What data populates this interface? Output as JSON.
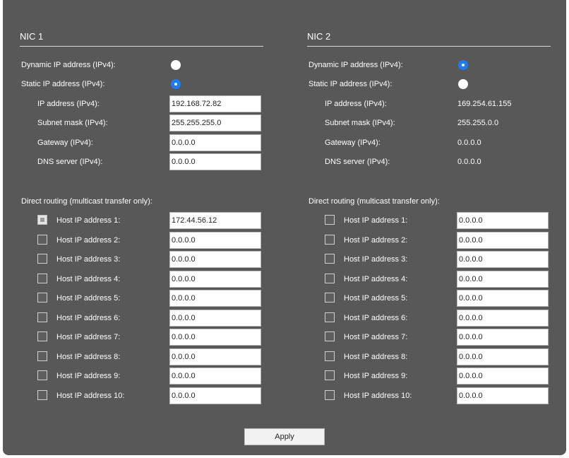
{
  "nic1": {
    "title": "NIC 1",
    "dynamic_label": "Dynamic IP address (IPv4):",
    "static_label": "Static IP address (IPv4):",
    "mode": "static",
    "ip_label": "IP address (IPv4):",
    "ip_value": "192.168.72.82",
    "subnet_label": "Subnet mask (IPv4):",
    "subnet_value": "255.255.255.0",
    "gateway_label": "Gateway (IPv4):",
    "gateway_value": "0.0.0.0",
    "dns_label": "DNS server (IPv4):",
    "dns_value": "0.0.0.0",
    "routing_label": "Direct routing (multicast transfer only):",
    "hosts": [
      {
        "label": "Host IP address 1:",
        "value": "172.44.56.12",
        "checked": true
      },
      {
        "label": "Host IP address 2:",
        "value": "0.0.0.0",
        "checked": false
      },
      {
        "label": "Host IP address 3:",
        "value": "0.0.0.0",
        "checked": false
      },
      {
        "label": "Host IP address 4:",
        "value": "0.0.0.0",
        "checked": false
      },
      {
        "label": "Host IP address 5:",
        "value": "0.0.0.0",
        "checked": false
      },
      {
        "label": "Host IP address 6:",
        "value": "0.0.0.0",
        "checked": false
      },
      {
        "label": "Host IP address 7:",
        "value": "0.0.0.0",
        "checked": false
      },
      {
        "label": "Host IP address 8:",
        "value": "0.0.0.0",
        "checked": false
      },
      {
        "label": "Host IP address 9:",
        "value": "0.0.0.0",
        "checked": false
      },
      {
        "label": "Host IP address 10:",
        "value": "0.0.0.0",
        "checked": false
      }
    ]
  },
  "nic2": {
    "title": "NIC 2",
    "dynamic_label": "Dynamic IP address (IPv4):",
    "static_label": "Static IP address (IPv4):",
    "mode": "dynamic",
    "ip_label": "IP address (IPv4):",
    "ip_value": "169.254.61.155",
    "subnet_label": "Subnet mask (IPv4):",
    "subnet_value": "255.255.0.0",
    "gateway_label": "Gateway (IPv4):",
    "gateway_value": "0.0.0.0",
    "dns_label": "DNS server (IPv4):",
    "dns_value": "0.0.0.0",
    "routing_label": "Direct routing (multicast transfer only):",
    "hosts": [
      {
        "label": "Host IP address 1:",
        "value": "0.0.0.0",
        "checked": false
      },
      {
        "label": "Host IP address 2:",
        "value": "0.0.0.0",
        "checked": false
      },
      {
        "label": "Host IP address 3:",
        "value": "0.0.0.0",
        "checked": false
      },
      {
        "label": "Host IP address 4:",
        "value": "0.0.0.0",
        "checked": false
      },
      {
        "label": "Host IP address 5:",
        "value": "0.0.0.0",
        "checked": false
      },
      {
        "label": "Host IP address 6:",
        "value": "0.0.0.0",
        "checked": false
      },
      {
        "label": "Host IP address 7:",
        "value": "0.0.0.0",
        "checked": false
      },
      {
        "label": "Host IP address 8:",
        "value": "0.0.0.0",
        "checked": false
      },
      {
        "label": "Host IP address 9:",
        "value": "0.0.0.0",
        "checked": false
      },
      {
        "label": "Host IP address 10:",
        "value": "0.0.0.0",
        "checked": false
      }
    ]
  },
  "apply_label": "Apply",
  "colors": {
    "panel_background": "#585858",
    "radio_selected": "#1e7bf0",
    "text": "#ffffff"
  }
}
